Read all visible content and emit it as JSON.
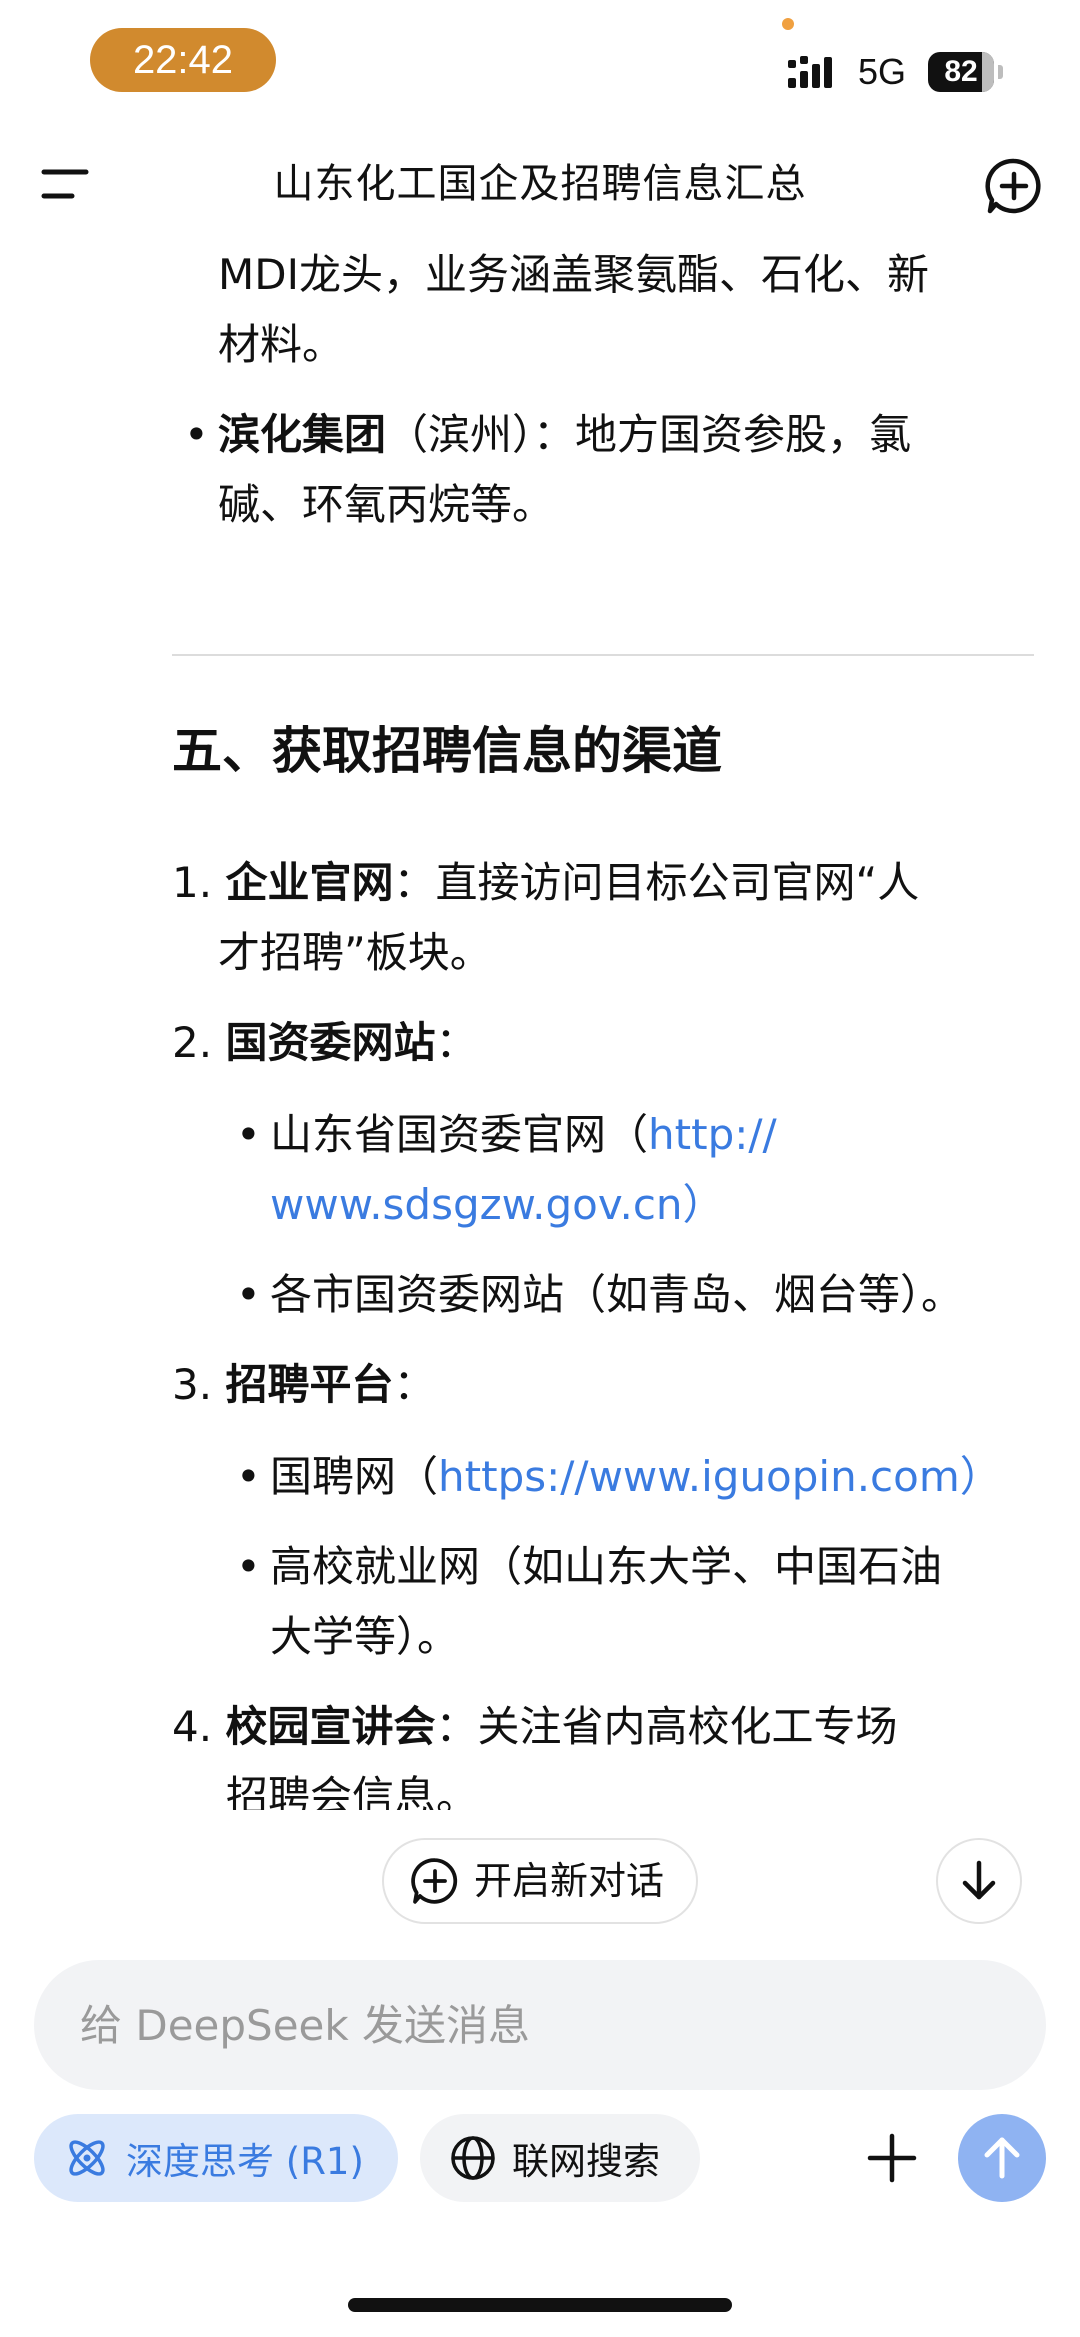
{
  "status_bar": {
    "time": "22:42",
    "network": "5G",
    "battery_level": "82",
    "battery_fraction": 0.82
  },
  "header": {
    "title": "山东化工国企及招聘信息汇总",
    "menu_icon": "menu-icon",
    "new_chat_icon": "plus-bubble-icon"
  },
  "content": {
    "prev_item": {
      "line1": "MDI龙头，业务涵盖聚氨酯、石化、新",
      "line2": "材料。"
    },
    "binhua": {
      "name": "滨化集团",
      "rest_line1": "（滨州）：地方国资参股，氯",
      "line2": "碱、环氧丙烷等。"
    },
    "section_title": "五、获取招聘信息的渠道",
    "items": [
      {
        "num": "1.",
        "label": "企业官网",
        "rest_line1": "：直接访问目标公司官网“人",
        "line2": "才招聘”板块。"
      },
      {
        "num": "2.",
        "label": "国资委网站",
        "rest_line1": "：",
        "subs": [
          {
            "text": "山东省国资委官网（",
            "link": "http://",
            "link2": "www.sdsgzw.gov.cn",
            "close": "）"
          },
          {
            "text": "各市国资委网站（如青岛、烟台等）。"
          }
        ]
      },
      {
        "num": "3.",
        "label": "招聘平台",
        "rest_line1": "：",
        "subs": [
          {
            "text": "国聘网（",
            "link": "https://www.iguopin.com",
            "close": "）"
          },
          {
            "line1": "高校就业网（如山东大学、中国石油",
            "line2": "大学等）。"
          }
        ]
      },
      {
        "num": "4.",
        "label": "校园宣讲会",
        "rest_line1": "：关注省内高校化工专场",
        "line2": "招聘会信息。"
      }
    ]
  },
  "floating": {
    "start_new_chat": "开启新对话",
    "scroll_down_icon": "arrow-down-icon"
  },
  "input": {
    "placeholder": "给 DeepSeek 发送消息"
  },
  "toolbar": {
    "deep_think": "深度思考 (R1)",
    "web_search": "联网搜索",
    "attach_icon": "plus-icon",
    "send_icon": "arrow-up-icon"
  },
  "colors": {
    "accent_blue": "#3a7be0",
    "time_pill": "#d18a2e",
    "deep_think_bg": "#dce8fb",
    "send_bg": "#8fb3f2"
  }
}
